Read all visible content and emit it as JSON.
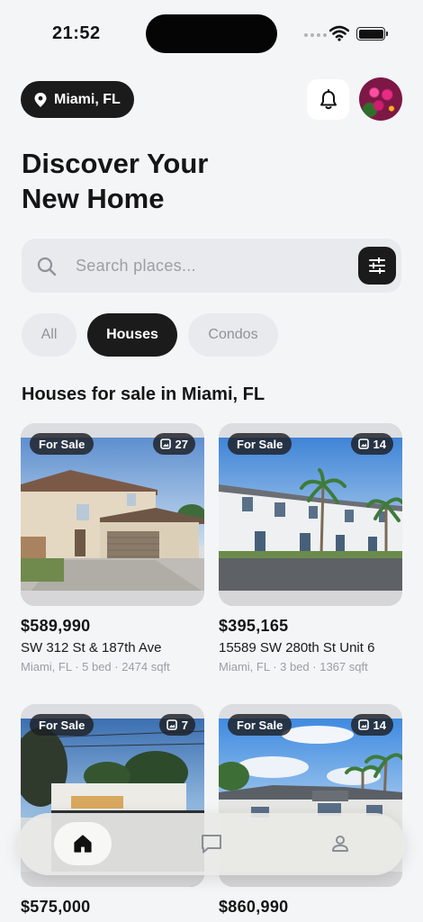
{
  "status_bar": {
    "time": "21:52"
  },
  "header": {
    "location": "Miami, FL",
    "title_line1": "Discover Your",
    "title_line2": "New Home"
  },
  "search": {
    "placeholder": "Search places..."
  },
  "tabs": [
    {
      "label": "All",
      "selected": false
    },
    {
      "label": "Houses",
      "selected": true
    },
    {
      "label": "Condos",
      "selected": false
    }
  ],
  "section_title": "Houses for sale in Miami, FL",
  "listings": [
    {
      "badge": "For Sale",
      "photos": "27",
      "price": "$589,990",
      "address": "SW 312 St & 187th Ave",
      "meta": "Miami, FL · 5 bed · 2474 sqft"
    },
    {
      "badge": "For Sale",
      "photos": "14",
      "price": "$395,165",
      "address": "15589 SW 280th St Unit 6",
      "meta": "Miami, FL · 3 bed · 1367 sqft"
    },
    {
      "badge": "For Sale",
      "photos": "7",
      "price": "$575,000"
    },
    {
      "badge": "For Sale",
      "photos": "14",
      "price": "$860,990"
    }
  ],
  "nav": [
    {
      "name": "home",
      "icon": "home-icon",
      "active": true
    },
    {
      "name": "messages",
      "icon": "chat-icon",
      "active": false
    },
    {
      "name": "profile",
      "icon": "user-icon",
      "active": false
    }
  ],
  "colors": {
    "dark": "#1b1b1b",
    "background": "#f4f5f7",
    "muted": "#9a9ea5"
  }
}
